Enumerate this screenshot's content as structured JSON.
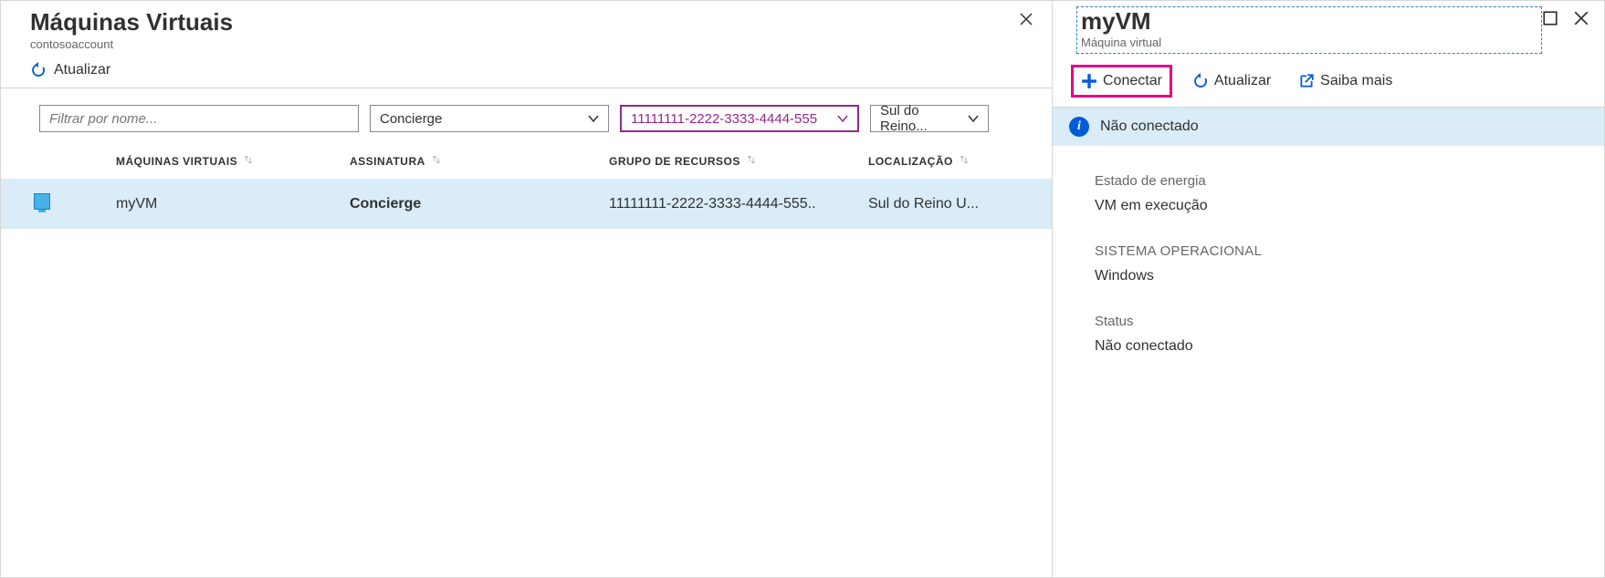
{
  "left": {
    "title": "Máquinas Virtuais",
    "subtitle": "contosoaccount",
    "refresh_label": "Atualizar",
    "filter_placeholder": "Filtrar por nome...",
    "dropdowns": {
      "subscription": "Concierge",
      "resource_group": "11111111-2222-3333-4444-555",
      "location": "Sul do Reino..."
    },
    "columns": {
      "vm": "MÁQUINAS VIRTUAIS",
      "sub": "ASSINATURA",
      "rg": "GRUPO DE RECURSOS",
      "loc": "LOCALIZAÇÃO"
    },
    "rows": [
      {
        "name": "myVM",
        "subscription": "Concierge",
        "resource_group": "11111111-2222-3333-4444-555..",
        "location": "Sul do Reino U..."
      }
    ]
  },
  "right": {
    "title": "myVM",
    "subtitle": "Máquina virtual",
    "toolbar": {
      "connect": "Conectar",
      "refresh": "Atualizar",
      "learn_more": "Saiba mais"
    },
    "status_bar": "Não conectado",
    "sections": {
      "power_label": "Estado de energia",
      "power_value": "VM em execução",
      "os_label": "SISTEMA OPERACIONAL",
      "os_value": "Windows",
      "status_label": "Status",
      "status_value": "Não conectado"
    }
  }
}
